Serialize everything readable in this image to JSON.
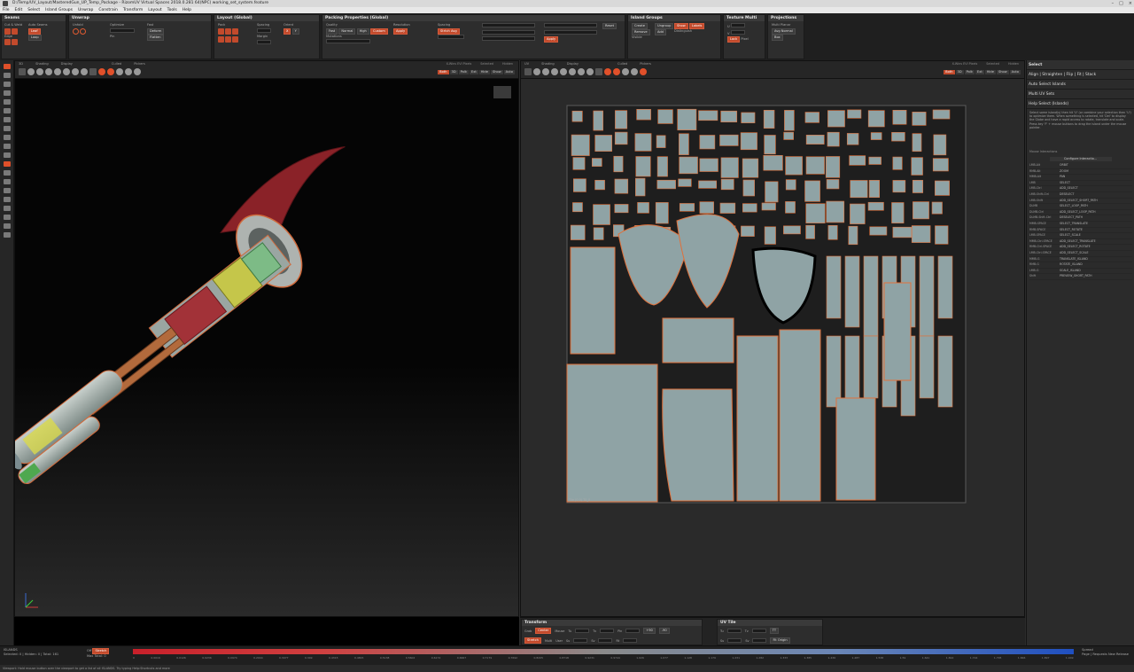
{
  "window": {
    "title": "D:/Temp/UV_Layout/MasteredGun_UP_Temp_Package - RizomUV  Virtual Spaces 2018.0.281  64(NPC) working_set_system.feature"
  },
  "menu": [
    "File",
    "Edit",
    "Select",
    "Island Groups",
    "Unwrap",
    "Constrain",
    "Transform",
    "Layout",
    "Tools",
    "Help"
  ],
  "toolbar": {
    "panels": [
      {
        "title": "Seams",
        "items": [
          "Cut & Weld",
          "Auto Seams",
          "Leaf",
          "Loop",
          "Edge",
          "Handles"
        ]
      },
      {
        "title": "Unwrap",
        "items": [
          "Unfold",
          "Optimize",
          "Pin",
          "Fast",
          "Deform",
          "Flatten"
        ]
      },
      {
        "title": "Layout (Global)",
        "items": [
          "Pack",
          "Fit",
          "Scale",
          "Orient",
          "Spacing",
          "Margin"
        ]
      },
      {
        "title": "Packing Properties (Global)",
        "items": [
          "Quality",
          "Fast",
          "Normal",
          "High",
          "Custom",
          "Mutations",
          "Resolution",
          "Spacing"
        ]
      },
      {
        "title": "Island Groups",
        "items": [
          "Create",
          "Remove",
          "Visible",
          "Ungroup",
          "Add",
          "Show",
          "Labels",
          "Distinguish"
        ]
      },
      {
        "title": "Texture Multi",
        "items": [
          "U",
          "V",
          "Lock",
          "Pixel",
          "Pix"
        ]
      },
      {
        "title": "Projections",
        "items": [
          "Multi Planar",
          "Avg Normal",
          "Box"
        ]
      }
    ]
  },
  "viewport3d": {
    "labels": [
      "3D",
      "Shading",
      "Display",
      "Culled",
      "Pickers"
    ],
    "right_labels": [
      "X-Wins EVI Pixels",
      "Selected",
      "Hidden"
    ],
    "modes": [
      "Both",
      "3D",
      "Polk",
      "Ext",
      "Hide",
      "Show",
      "Auto"
    ]
  },
  "viewportuv": {
    "labels": [
      "UV",
      "Shading",
      "Display",
      "Culled",
      "Pickers"
    ],
    "right_labels": [
      "X-Wins EVI Pixels",
      "Selected",
      "Hidden"
    ],
    "modes": [
      "Both",
      "3D",
      "Polk",
      "Ext",
      "Hide",
      "Show",
      "Auto"
    ],
    "tile_label": "Tile (0,0) T0_0"
  },
  "select_panel": {
    "title": "Select",
    "items": [
      "Align | Straighten | Flip | Fit | Stack",
      "Auto Select Islands",
      "Multi UV Sets",
      "Help Select (Islands)"
    ],
    "help_text": "Select some island(s) then hit 'U' (or combine your selection then 'U') to optimize them. When something is selected, hit 'Del' to display the Globe and have a rapid access to rotate, translate and scale. Press key 'F' + mouse buttons to drag the island under the mouse pointer.",
    "mouse_label": "Mouse Interactions",
    "configure": "Configure Interactio...",
    "bindings": [
      [
        "LMB-Alt",
        "ORBIT"
      ],
      [
        "RMB-Alt",
        "ZOOM"
      ],
      [
        "MMB-Alt",
        "PAN"
      ],
      [
        "LMB",
        "SELECT"
      ],
      [
        "LMB-Ctrl",
        "ADD_SELECT"
      ],
      [
        "LMB-Shift-Ctrl",
        "DESELECT"
      ],
      [
        "LMB-Shift",
        "ADD_SELECT_SHORT_PATH"
      ],
      [
        "DLMB",
        "SELECT_LOOP_PATH"
      ],
      [
        "DLMB-Ctrl",
        "ADD_SELECT_LOOP_PATH"
      ],
      [
        "DLMB-Shift-Ctrl",
        "DESELECT_PATH"
      ],
      [
        "MMB-SPACE",
        "SELECT_TRANSLATE"
      ],
      [
        "RMB-SPACE",
        "SELECT_ROTATE"
      ],
      [
        "LMB-SPACE",
        "SELECT_SCALE"
      ],
      [
        "MMB-Ctrl-SPACE",
        "ADD_SELECT_TRANSLATE"
      ],
      [
        "RMB-Ctrl-SPACE",
        "ADD_SELECT_ROTATE"
      ],
      [
        "LMB-Ctrl-SPACE",
        "ADD_SELECT_SCALE"
      ],
      [
        "MMB-G",
        "TRANSLATE_ISLAND"
      ],
      [
        "RMB-G",
        "ROTATE_ISLAND"
      ],
      [
        "LMB-G",
        "SCALE_ISLAND"
      ],
      [
        "Shift",
        "PREVIEW_SHORT_PATH"
      ]
    ]
  },
  "transform_panel": {
    "title": "Transform",
    "row1": [
      "Grab",
      "Center",
      "Mouse",
      "Tu",
      "0",
      "Tv",
      "0",
      "Pin",
      "0",
      "+90",
      "-90"
    ],
    "row2": [
      "Stretch",
      "Multi",
      "User",
      "Su",
      "1",
      "Sv",
      "1",
      "Rt",
      "0",
      "0"
    ]
  },
  "uvtile_panel": {
    "title": "UV Tile",
    "row1": [
      "Tu",
      "0",
      "Tv",
      "0",
      "TT"
    ],
    "row2": [
      "Su",
      "1",
      "Sv",
      "1",
      "Fit Origin"
    ]
  },
  "statusbar": {
    "left_1": "ISLANDS",
    "left_2": "Selected: 0 | Hidden: 0 | Total: 161",
    "mode_label": "Stretch",
    "off_label": "Off",
    "max_label": "Max",
    "total_label": "Total: 0",
    "right_1": "Spread",
    "right_2": "Page | Requests",
    "right_3": "New Release",
    "ticks": [
      "0",
      "0.0016",
      "0.0126",
      "0.0236",
      "0.0974",
      "0.2044",
      "0.3077",
      "0.349",
      "0.4315",
      "0.4815",
      "0.5138",
      "0.5602",
      "0.6174",
      "0.6667",
      "0.7179",
      "0.7692",
      "0.8205",
      "0.8718",
      "0.9231",
      "0.9744",
      "1.026",
      "1.077",
      "1.128",
      "1.179",
      "1.231",
      "1.282",
      "1.333",
      "1.385",
      "1.436",
      "1.487",
      "1.538",
      "1.59",
      "1.641",
      "1.692",
      "1.744",
      "1.795",
      "1.846",
      "1.897",
      "1.949"
    ]
  },
  "footer": "Viewport: Hold mouse button over the viewport to get a list of all ISLANDS. Try typing Help:Shortcuts and more"
}
